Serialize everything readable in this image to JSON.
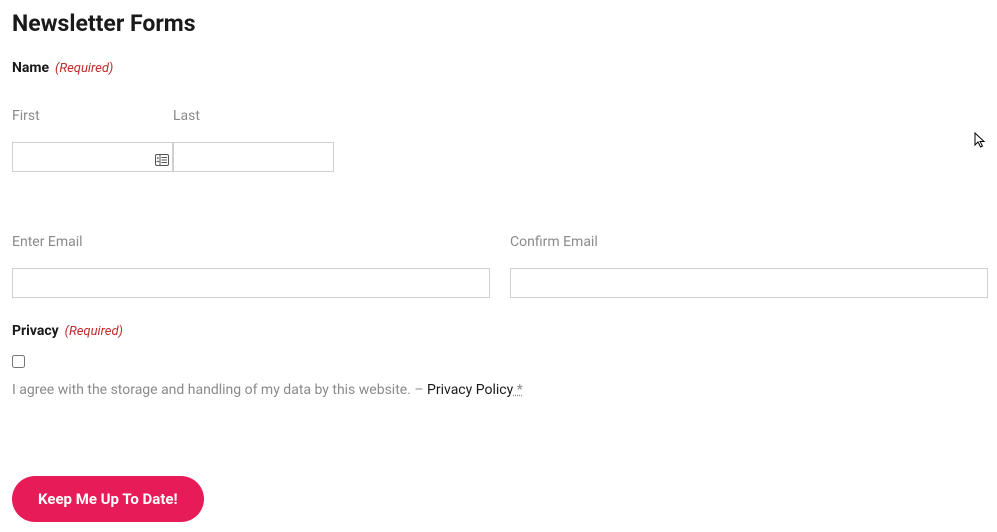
{
  "page_title": "Newsletter Forms",
  "name_section": {
    "label": "Name",
    "required": "(Required)",
    "first_label": "First",
    "last_label": "Last",
    "first_value": "",
    "last_value": ""
  },
  "email_section": {
    "enter_label": "Enter Email",
    "confirm_label": "Confirm Email",
    "enter_value": "",
    "confirm_value": ""
  },
  "privacy_section": {
    "label": "Privacy",
    "required": "(Required)",
    "consent_text": "I agree with the storage and handling of my data by this website. – ",
    "link_text": "Privacy Policy",
    "asterisk": " *"
  },
  "submit_label": "Keep Me Up To Date!"
}
